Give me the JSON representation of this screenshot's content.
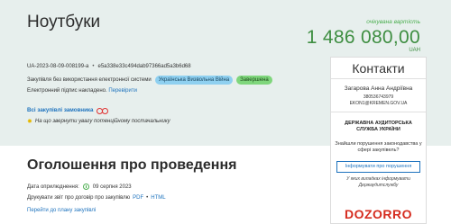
{
  "header": {
    "title": "Ноутбуки",
    "expected_value_label": "очікувана вартість",
    "expected_value": "1 486 080,00",
    "currency": "UAH"
  },
  "tender": {
    "id": "UA-2023-08-09-008199-a",
    "separator": "•",
    "hash": "e5a338e33c494dab97366ad5a3b6d68"
  },
  "tags": {
    "text": "Закупівля без використання електронної системи",
    "campaign": "Українська Визвольна Війна",
    "status": "Завершена"
  },
  "signature": {
    "text": "Електронний підпис накладено.",
    "verify_link": "Перевірити"
  },
  "links": {
    "all_purchases": "Всі закупівлі замовника",
    "attention": "На що звернути увагу потенційному постачальнику"
  },
  "contacts": {
    "header": "Контакти",
    "name": "Загарова Анна Андріївна",
    "phone": "380536743979",
    "email": "EKON1@KREMEN.GOV.UA"
  },
  "audit": {
    "title": "ДЕРЖАВНА АУДИТОРСЬКА СЛУЖБА УКРАЇНИ",
    "text": "Знайшли порушення законодавства у сфері закупівель?",
    "button": "Інформувати про порушення",
    "note": "У яких випадках інформувати Держаудитслужбу"
  },
  "brand": {
    "name": "DOZORRO"
  },
  "announcement": {
    "title": "Оголошення про проведення",
    "publish_label": "Дата оприлюднення:",
    "publish_date": "09 серпня 2023",
    "print_text": "Друкувати звіт про договір про закупівлю",
    "pdf_link": "PDF",
    "html_link": "HTML",
    "plan_link": "Перейти до плану закупівлі"
  },
  "colors": {
    "panel_background": "#e7efed",
    "price_green": "#3e8e41",
    "link_blue": "#1e73be",
    "tag_blue": "#8fd0f0",
    "tag_green": "#7fd67c",
    "brand_red": "#d52b1e"
  },
  "icons": {
    "binoculars": "binoculars-icon",
    "attention": "pin-icon",
    "clock": "clock-icon"
  }
}
